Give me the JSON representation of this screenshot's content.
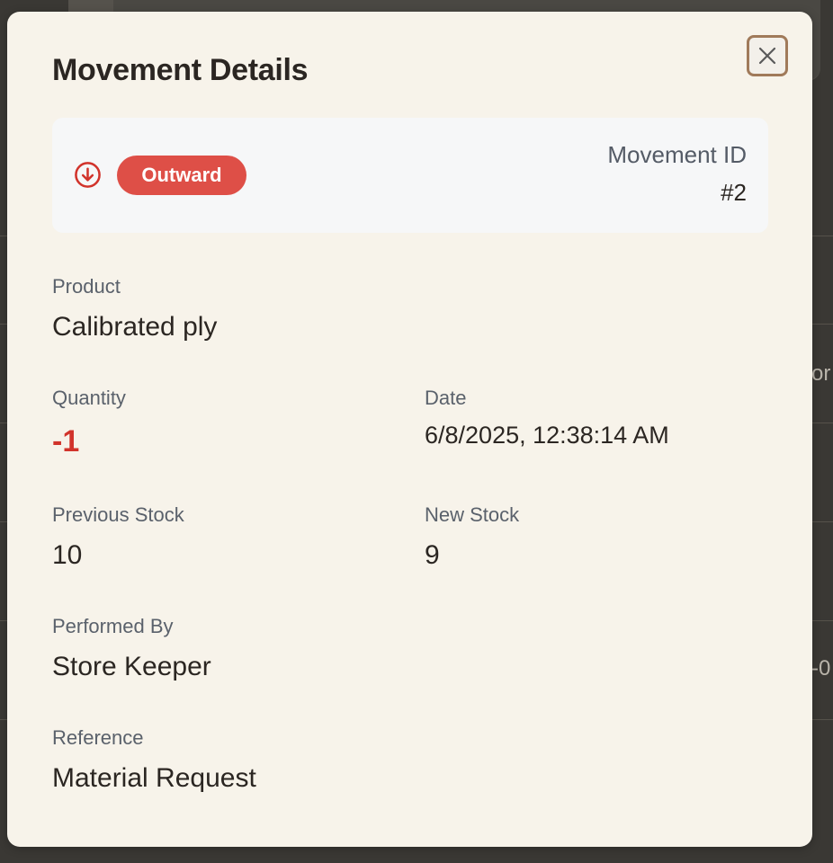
{
  "modal": {
    "title": "Movement Details",
    "close_icon": "close-icon"
  },
  "summary": {
    "direction_icon": "arrow-down-circle-icon",
    "type_label": "Outward",
    "type_color": "#de4f47",
    "movement_id_label": "Movement ID",
    "movement_id_value": "#2"
  },
  "fields": {
    "product": {
      "label": "Product",
      "value": "Calibrated ply"
    },
    "quantity": {
      "label": "Quantity",
      "value": "-1",
      "color": "#d1332b"
    },
    "date": {
      "label": "Date",
      "value": "6/8/2025, 12:38:14 AM"
    },
    "previous_stock": {
      "label": "Previous Stock",
      "value": "10"
    },
    "new_stock": {
      "label": "New Stock",
      "value": "9"
    },
    "performed_by": {
      "label": "Performed By",
      "value": "Store Keeper"
    },
    "reference": {
      "label": "Reference",
      "value": "Material Request"
    }
  },
  "background": {
    "partial_texts": [
      "or",
      "-0"
    ]
  }
}
